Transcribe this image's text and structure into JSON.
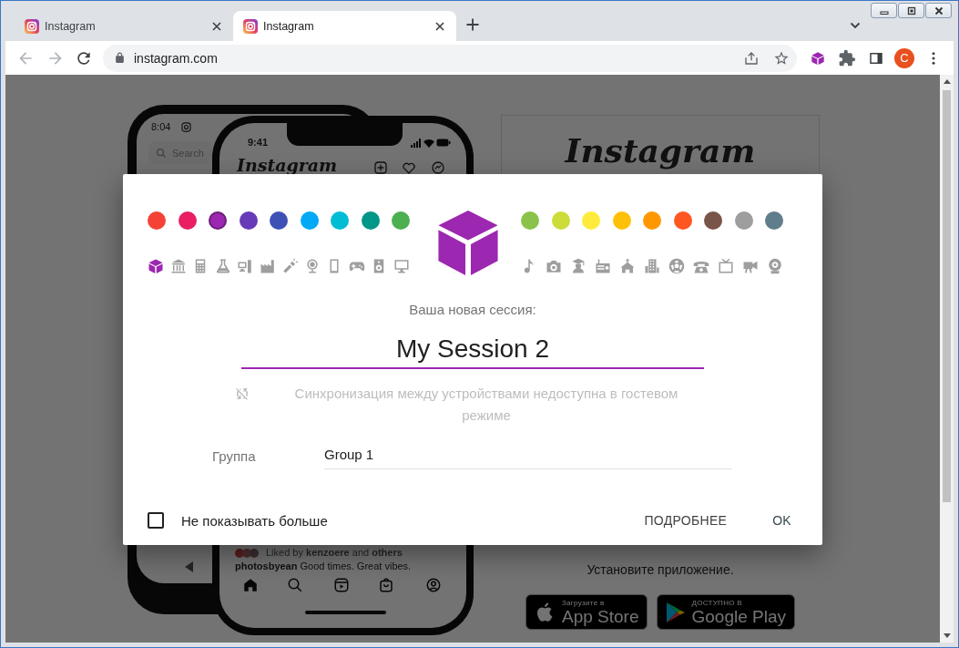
{
  "browser": {
    "tabs": [
      {
        "title": "Instagram",
        "selected": false
      },
      {
        "title": "Instagram",
        "selected": true
      }
    ],
    "address": "instagram.com",
    "profile_initial": "C"
  },
  "page": {
    "back_phone": {
      "time": "8:04",
      "search_placeholder": "Search"
    },
    "front_phone": {
      "time": "9:41",
      "logo": "Instagram",
      "likes": "Liked by **kenzoere** and **others**",
      "caption": "**photosbyean** Good times. Great vibes."
    },
    "card_logo": "Instagram",
    "get_app": "Установите приложение.",
    "badges": [
      {
        "kind": "apple",
        "line1": "Загрузите в",
        "line2": "App Store"
      },
      {
        "kind": "google",
        "line1": "ДОСТУПНО В",
        "line2": "Google Play"
      }
    ]
  },
  "dialog": {
    "colors": [
      {
        "color": "#f44336",
        "selected": false
      },
      {
        "color": "#e91e63",
        "selected": false
      },
      {
        "color": "#9c27b0",
        "selected": true
      },
      {
        "color": "#673ab7",
        "selected": false
      },
      {
        "color": "#3f51b5",
        "selected": false
      },
      {
        "color": "#03a9f4",
        "selected": false
      },
      {
        "color": "#00bcd4",
        "selected": false
      },
      {
        "color": "#009688",
        "selected": false
      },
      {
        "color": "#4caf50",
        "selected": false
      },
      {
        "color": "#8bc34a",
        "selected": false
      },
      {
        "color": "#cddc39",
        "selected": false
      },
      {
        "color": "#ffeb3b",
        "selected": false
      },
      {
        "color": "#ffc107",
        "selected": false
      },
      {
        "color": "#ff9800",
        "selected": false
      },
      {
        "color": "#ff5722",
        "selected": false
      },
      {
        "color": "#795548",
        "selected": false
      },
      {
        "color": "#9e9e9e",
        "selected": false
      },
      {
        "color": "#607d8b",
        "selected": false
      }
    ],
    "icons": [
      {
        "selected": true
      },
      {
        "selected": false
      },
      {
        "selected": false
      },
      {
        "selected": false
      },
      {
        "selected": false
      },
      {
        "selected": false
      },
      {
        "selected": false
      },
      {
        "selected": false
      },
      {
        "selected": false
      },
      {
        "selected": false
      },
      {
        "selected": false
      },
      {
        "selected": false
      },
      {
        "selected": false
      },
      {
        "selected": false
      },
      {
        "selected": false
      },
      {
        "selected": false
      },
      {
        "selected": false
      },
      {
        "selected": false
      },
      {
        "selected": false
      },
      {
        "selected": false
      },
      {
        "selected": false
      },
      {
        "selected": false
      },
      {
        "selected": false
      }
    ],
    "session_label": "Ваша новая сессия:",
    "session_name": "My Session 2",
    "sync_notice": "Синхронизация между устройствами недоступна в гостевом режиме",
    "group_label": "Группа",
    "group_value": "Group 1",
    "dont_show": {
      "label": "Не показывать больше",
      "checked": false
    },
    "buttons": [
      "ПОДРОБНЕЕ",
      "OK"
    ]
  }
}
